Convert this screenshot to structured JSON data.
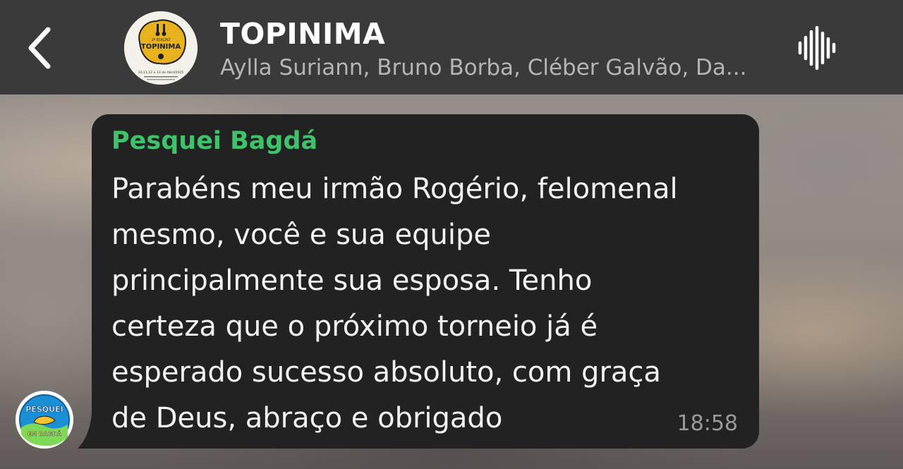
{
  "header": {
    "title": "TOPINIMA",
    "participants": "Aylla Suriann, Bruno Borba, Cléber Galvão, Da...",
    "back_icon": "chevron-left-icon",
    "audio_icon": "audio-waveform-icon",
    "group_logo": {
      "name": "TOPINIMA",
      "edition": "2ª EDIÇÃO",
      "dates": "10,11,12 e 13 de Abril/2025"
    }
  },
  "message": {
    "sender": "Pesquei Bagdá",
    "sender_color": "#3ec26a",
    "lines": [
      "Parabéns meu irmão Rogério, felomenal",
      "mesmo, você e sua equipe",
      "principalmente sua esposa. Tenho",
      "certeza que o próximo torneio já é",
      "esperado sucesso absoluto, com graça",
      "de Deus, abraço e obrigado"
    ],
    "time": "18:58",
    "sender_logo": {
      "line1": "PESQUEI",
      "line2": "EM BAGDÁ"
    }
  },
  "colors": {
    "header_bg": "#3a3a3a",
    "bubble_bg": "#222222",
    "text": "#f2f2f2",
    "muted": "#9a9a9a"
  }
}
